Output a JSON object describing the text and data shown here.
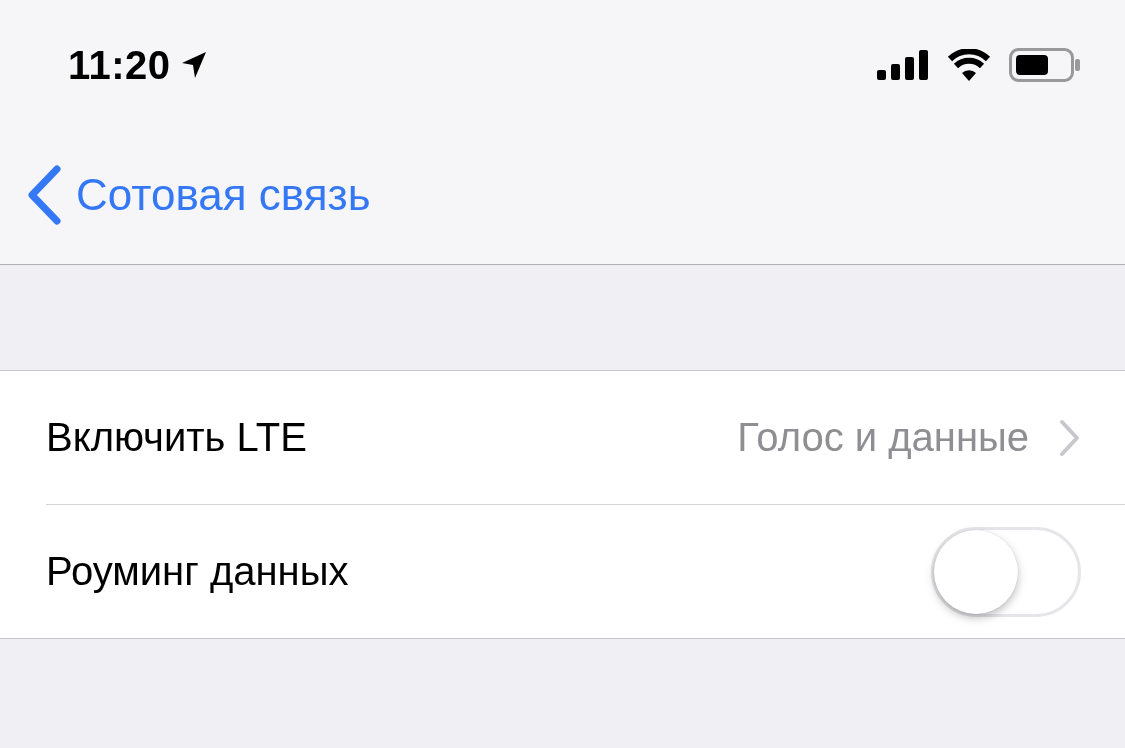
{
  "status_bar": {
    "time": "11:20"
  },
  "nav_bar": {
    "back_label": "Сотовая связь"
  },
  "rows": [
    {
      "kind": "disclosure",
      "label": "Включить LTE",
      "value": "Голос и данные"
    },
    {
      "kind": "toggle",
      "label": "Роуминг данных",
      "on": false
    }
  ]
}
